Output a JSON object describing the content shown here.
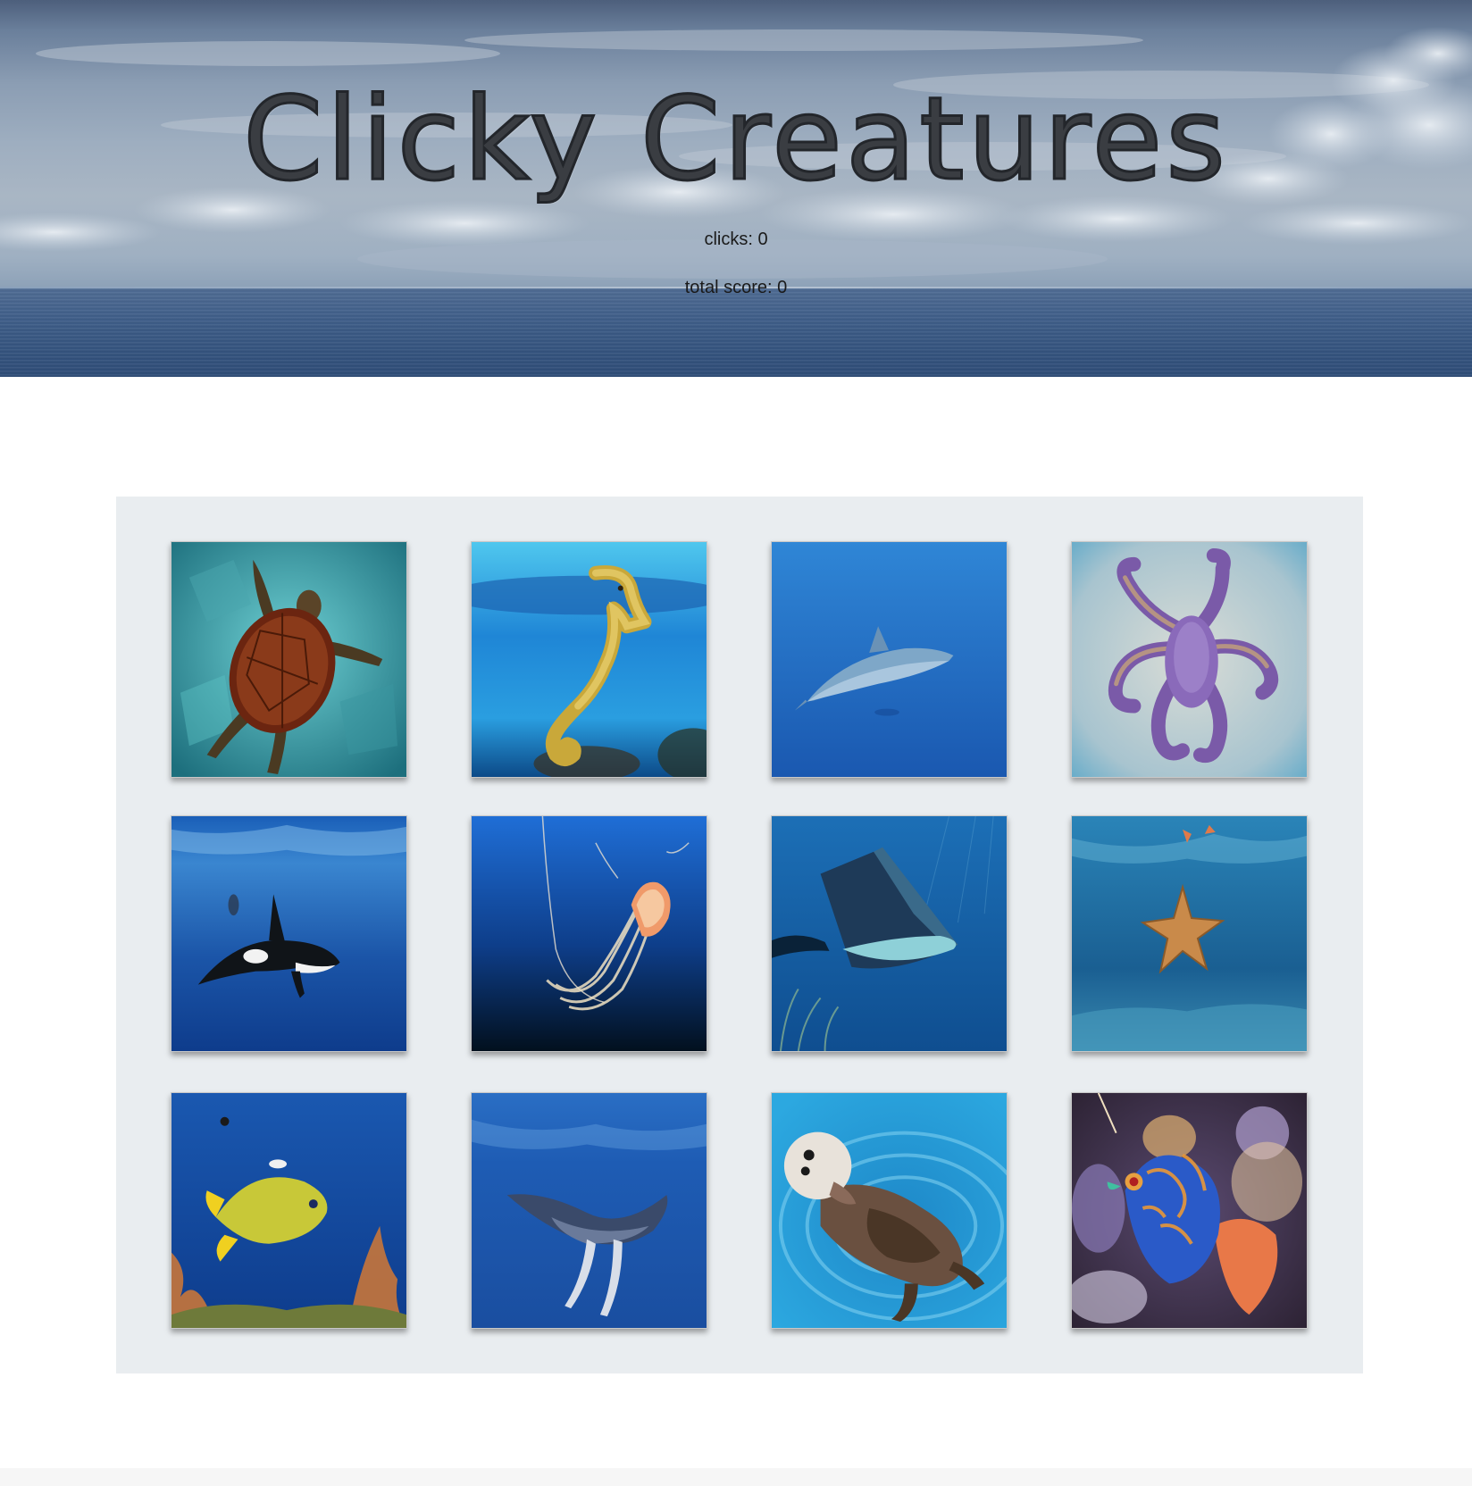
{
  "header": {
    "title": "Clicky Creatures",
    "clicks_label": "clicks: 0",
    "score_label": "total score: 0"
  },
  "board": {
    "cards": [
      {
        "icon": "sea-turtle-icon"
      },
      {
        "icon": "seahorse-icon"
      },
      {
        "icon": "dolphin-icon"
      },
      {
        "icon": "octopus-icon"
      },
      {
        "icon": "orca-icon"
      },
      {
        "icon": "jellyfish-icon"
      },
      {
        "icon": "manta-ray-icon"
      },
      {
        "icon": "starfish-icon"
      },
      {
        "icon": "angelfish-icon"
      },
      {
        "icon": "humpback-whale-icon"
      },
      {
        "icon": "sea-otter-icon"
      },
      {
        "icon": "mandarin-fish-icon"
      }
    ]
  },
  "colors": {
    "board_background": "#e9edf0",
    "title_color": "#3a3d42"
  }
}
